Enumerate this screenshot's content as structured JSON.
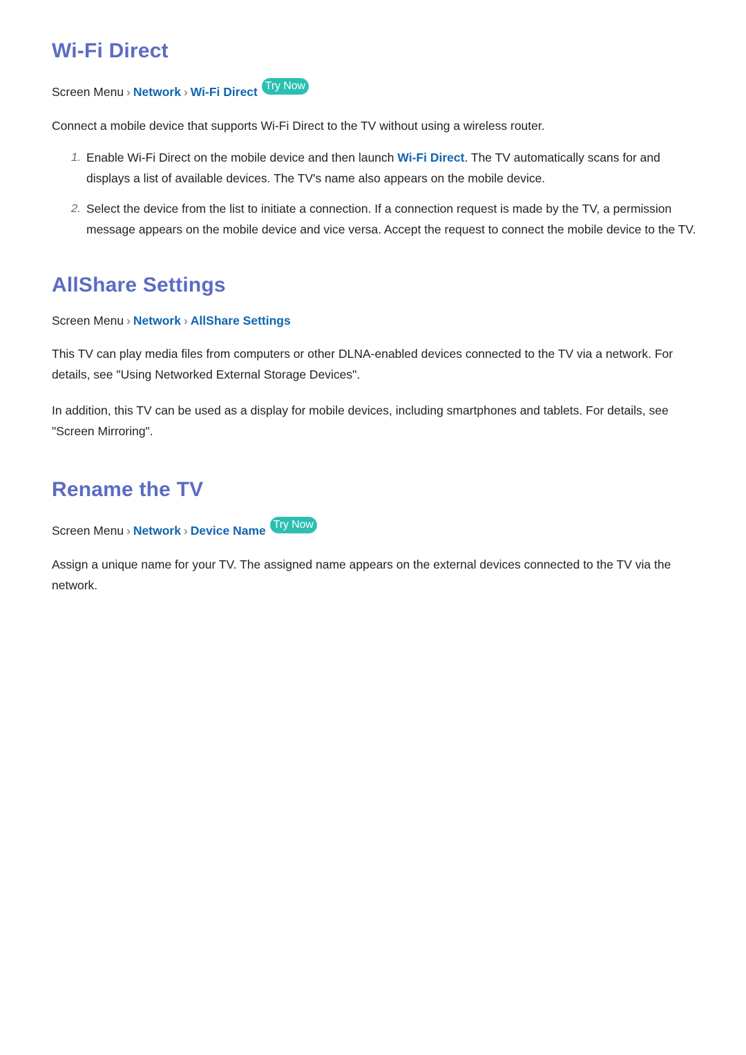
{
  "sections": [
    {
      "id": "wifi-direct",
      "title": "Wi-Fi Direct",
      "breadcrumb": {
        "root": "Screen Menu",
        "sep": "›",
        "link1": "Network",
        "link2": "Wi-Fi Direct",
        "badge": "Try Now"
      },
      "intro": "Connect a mobile device that supports Wi-Fi Direct to the TV without using a wireless router.",
      "steps": [
        {
          "number": "1.",
          "text_before": "Enable Wi-Fi Direct on the mobile device and then launch ",
          "link": "Wi-Fi Direct",
          "text_after": ". The TV automatically scans for and displays a list of available devices. The TV's name also appears on the mobile device."
        },
        {
          "number": "2.",
          "text_before": "Select the device from the list to initiate a connection. If a connection request is made by the TV, a permission message appears on the mobile device and vice versa. Accept the request to connect the mobile device to the TV.",
          "link": "",
          "text_after": ""
        }
      ]
    },
    {
      "id": "allshare-settings",
      "title": "AllShare Settings",
      "breadcrumb": {
        "root": "Screen Menu",
        "sep": "›",
        "link1": "Network",
        "link2": "AllShare Settings",
        "badge": ""
      },
      "paragraphs": [
        "This TV can play media files from computers or other DLNA-enabled devices connected to the TV via a network. For details, see \"Using Networked External Storage Devices\".",
        "In addition, this TV can be used as a display for mobile devices, including smartphones and tablets. For details, see \"Screen Mirroring\"."
      ]
    },
    {
      "id": "rename-the-tv",
      "title": "Rename the TV",
      "breadcrumb": {
        "root": "Screen Menu",
        "sep": "›",
        "link1": "Network",
        "link2": "Device Name",
        "badge": "Try Now"
      },
      "paragraphs": [
        "Assign a unique name for your TV. The assigned name appears on the external devices connected to the TV via the network."
      ]
    }
  ],
  "colors": {
    "heading": "#5b6cc4",
    "link": "#1165b0",
    "badge_bg": "#2bbfb3",
    "body": "#231f20",
    "separator": "#6f6f6f",
    "list_number": "#6d6d6d"
  }
}
